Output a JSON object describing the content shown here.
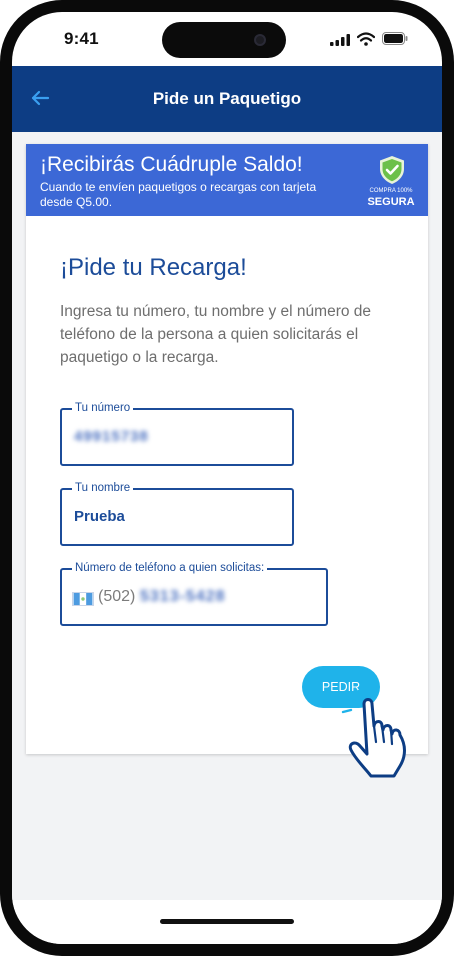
{
  "status_bar": {
    "time": "9:41"
  },
  "header": {
    "title": "Pide un Paquetigo"
  },
  "promo": {
    "title": "¡Recibirás Cuádruple Saldo!",
    "subtitle": "Cuando te envíen paquetigos o recargas con tarjeta desde Q5.00.",
    "badge_small": "COMPRA 100%",
    "badge_large": "SEGURA"
  },
  "form": {
    "heading": "¡Pide tu Recarga!",
    "description": "Ingresa tu número, tu nombre y el número de teléfono de la persona a quien solicitarás el paquetigo o la recarga.",
    "number_field": {
      "label": "Tu número",
      "value": "49915738"
    },
    "name_field": {
      "label": "Tu nombre",
      "value": "Prueba"
    },
    "recipient_field": {
      "label": "Número de teléfono a quien solicitas:",
      "prefix": "(502)",
      "value": "5313-5428"
    },
    "submit_label": "PEDIR"
  },
  "colors": {
    "header_bg": "#0d3d84",
    "promo_bg": "#3c68d6",
    "accent_text": "#1c4c99",
    "button_bg": "#1fb3ea"
  },
  "icons": [
    "back-arrow-icon",
    "shield-check-icon",
    "guatemala-flag-icon",
    "pointing-hand-icon"
  ]
}
